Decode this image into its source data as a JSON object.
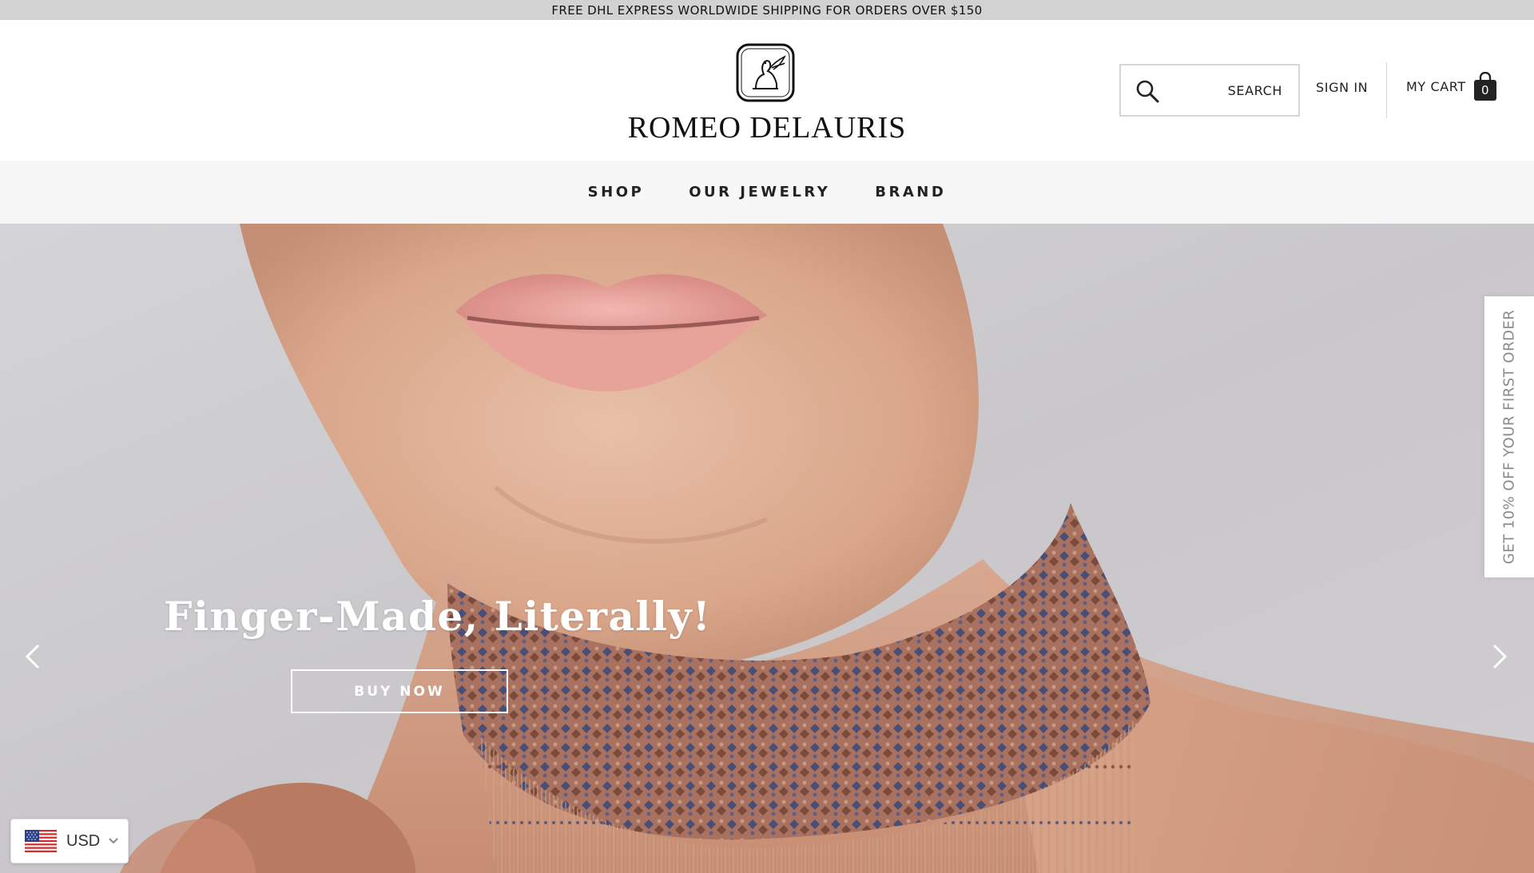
{
  "promo": {
    "text": "FREE DHL EXPRESS WORLDWIDE SHIPPING FOR ORDERS OVER $150"
  },
  "header": {
    "logo_text": "ROMEO DELAURIS",
    "search_label": "SEARCH",
    "signin_label": "SIGN IN",
    "cart_label": "MY CART",
    "cart_count": "0"
  },
  "nav": {
    "items": [
      {
        "label": "SHOP"
      },
      {
        "label": "OUR JEWELRY"
      },
      {
        "label": "BRAND"
      }
    ]
  },
  "hero": {
    "headline": "Finger-Made, Literally!",
    "cta_label": "BUY NOW",
    "icons": {
      "prev": "chevron-left-icon",
      "next": "chevron-right-icon"
    }
  },
  "discount_tab": {
    "text": "GET 10% OFF YOUR FIRST ORDER"
  },
  "currency": {
    "code": "USD",
    "flag": "us-flag-icon"
  },
  "colors": {
    "promo_bg": "#d2d2d2",
    "nav_bg": "#f7f7f7",
    "text_dark": "#1a1a1a",
    "discount_text": "#8a8a8a"
  }
}
